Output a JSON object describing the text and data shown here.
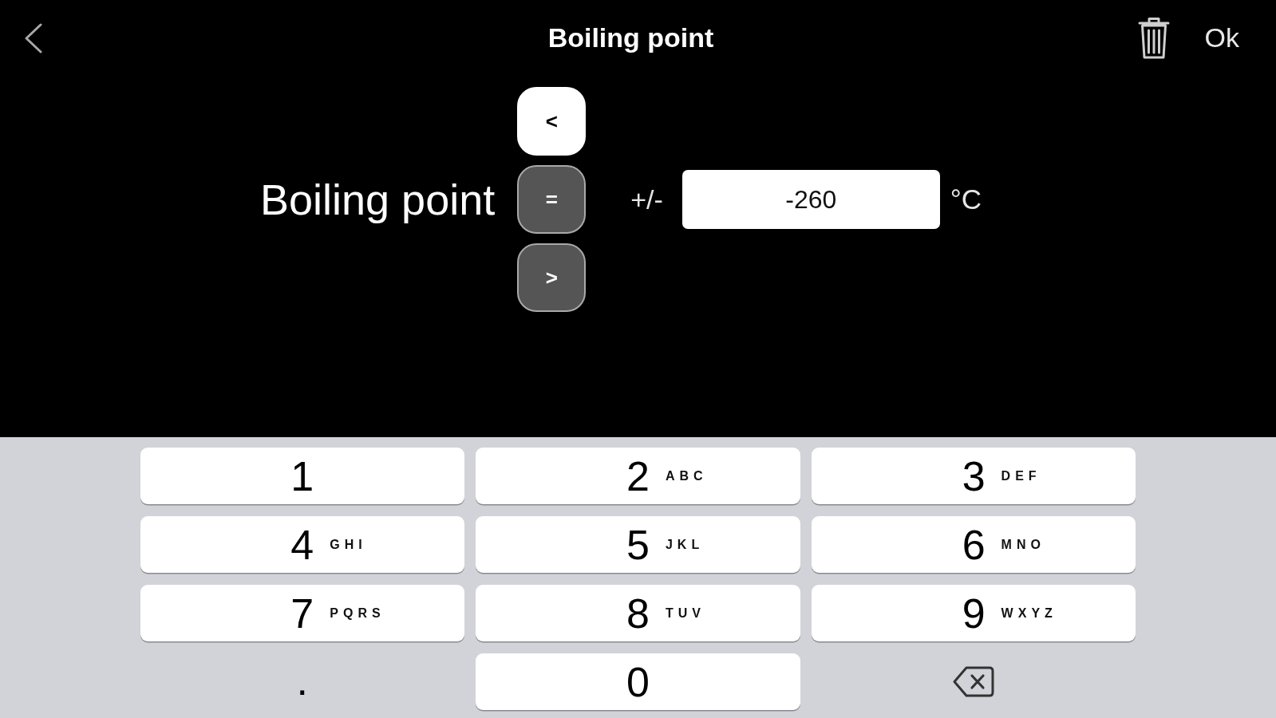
{
  "nav_bar": {
    "title": "Boiling point",
    "done_label": "Ok"
  },
  "condition": {
    "label": "Boiling point",
    "operators": [
      {
        "label": "<",
        "selected": true
      },
      {
        "label": "=",
        "selected": false
      },
      {
        "label": ">",
        "selected": false
      }
    ],
    "tolerance_label": "+/-",
    "value": "-260",
    "unit": "°C"
  },
  "keypad": {
    "rows": [
      {
        "keys": [
          {
            "kind": "digit",
            "label": "1"
          },
          {
            "kind": "digit",
            "label": "2",
            "letters": "ABC"
          },
          {
            "kind": "digit",
            "label": "3",
            "letters": "DEF"
          }
        ]
      },
      {
        "keys": [
          {
            "kind": "digit",
            "label": "4",
            "letters": "GHI"
          },
          {
            "kind": "digit",
            "label": "5",
            "letters": "JKL"
          },
          {
            "kind": "digit",
            "label": "6",
            "letters": "MNO"
          }
        ]
      },
      {
        "keys": [
          {
            "kind": "digit",
            "label": "7",
            "letters": "PQRS"
          },
          {
            "kind": "digit",
            "label": "8",
            "letters": "TUV"
          },
          {
            "kind": "digit",
            "label": "9",
            "letters": "WXYZ"
          }
        ]
      },
      {
        "keys": [
          {
            "kind": "symbol",
            "label": "."
          },
          {
            "kind": "digit",
            "label": "0"
          },
          {
            "kind": "delete"
          }
        ]
      }
    ]
  }
}
